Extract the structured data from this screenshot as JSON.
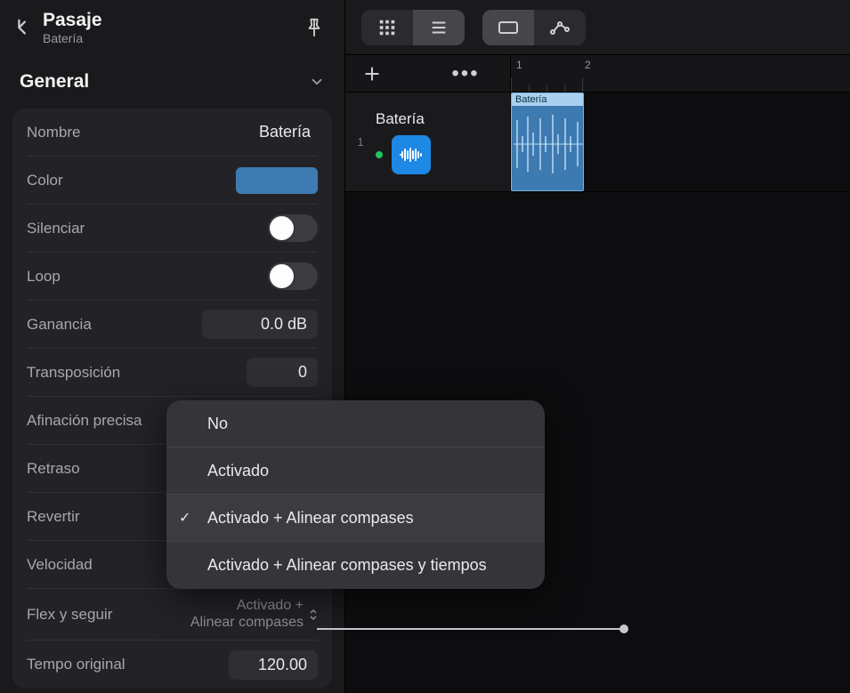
{
  "header": {
    "title": "Pasaje",
    "subtitle": "Batería"
  },
  "section": {
    "title": "General"
  },
  "rows": {
    "name_label": "Nombre",
    "name_value": "Batería",
    "color_label": "Color",
    "color_hex": "#3f7bb3",
    "mute_label": "Silenciar",
    "loop_label": "Loop",
    "gain_label": "Ganancia",
    "gain_value": "0.0 dB",
    "transpose_label": "Transposición",
    "transpose_value": "0",
    "finetune_label": "Afinación precisa",
    "delay_label": "Retraso",
    "reverse_label": "Revertir",
    "speed_label": "Velocidad",
    "flexfollow_label": "Flex y seguir",
    "flexfollow_value_line1": "Activado +",
    "flexfollow_value_line2": "Alinear compases",
    "origtempo_label": "Tempo original",
    "origtempo_value": "120.00"
  },
  "menu": {
    "items": [
      "No",
      "Activado",
      "Activado + Alinear compases",
      "Activado + Alinear compases y tiempos"
    ],
    "selected_index": 2
  },
  "timeline": {
    "ticks": [
      "1",
      "2"
    ]
  },
  "track": {
    "number": "1",
    "name": "Batería",
    "region_name": "Batería"
  }
}
